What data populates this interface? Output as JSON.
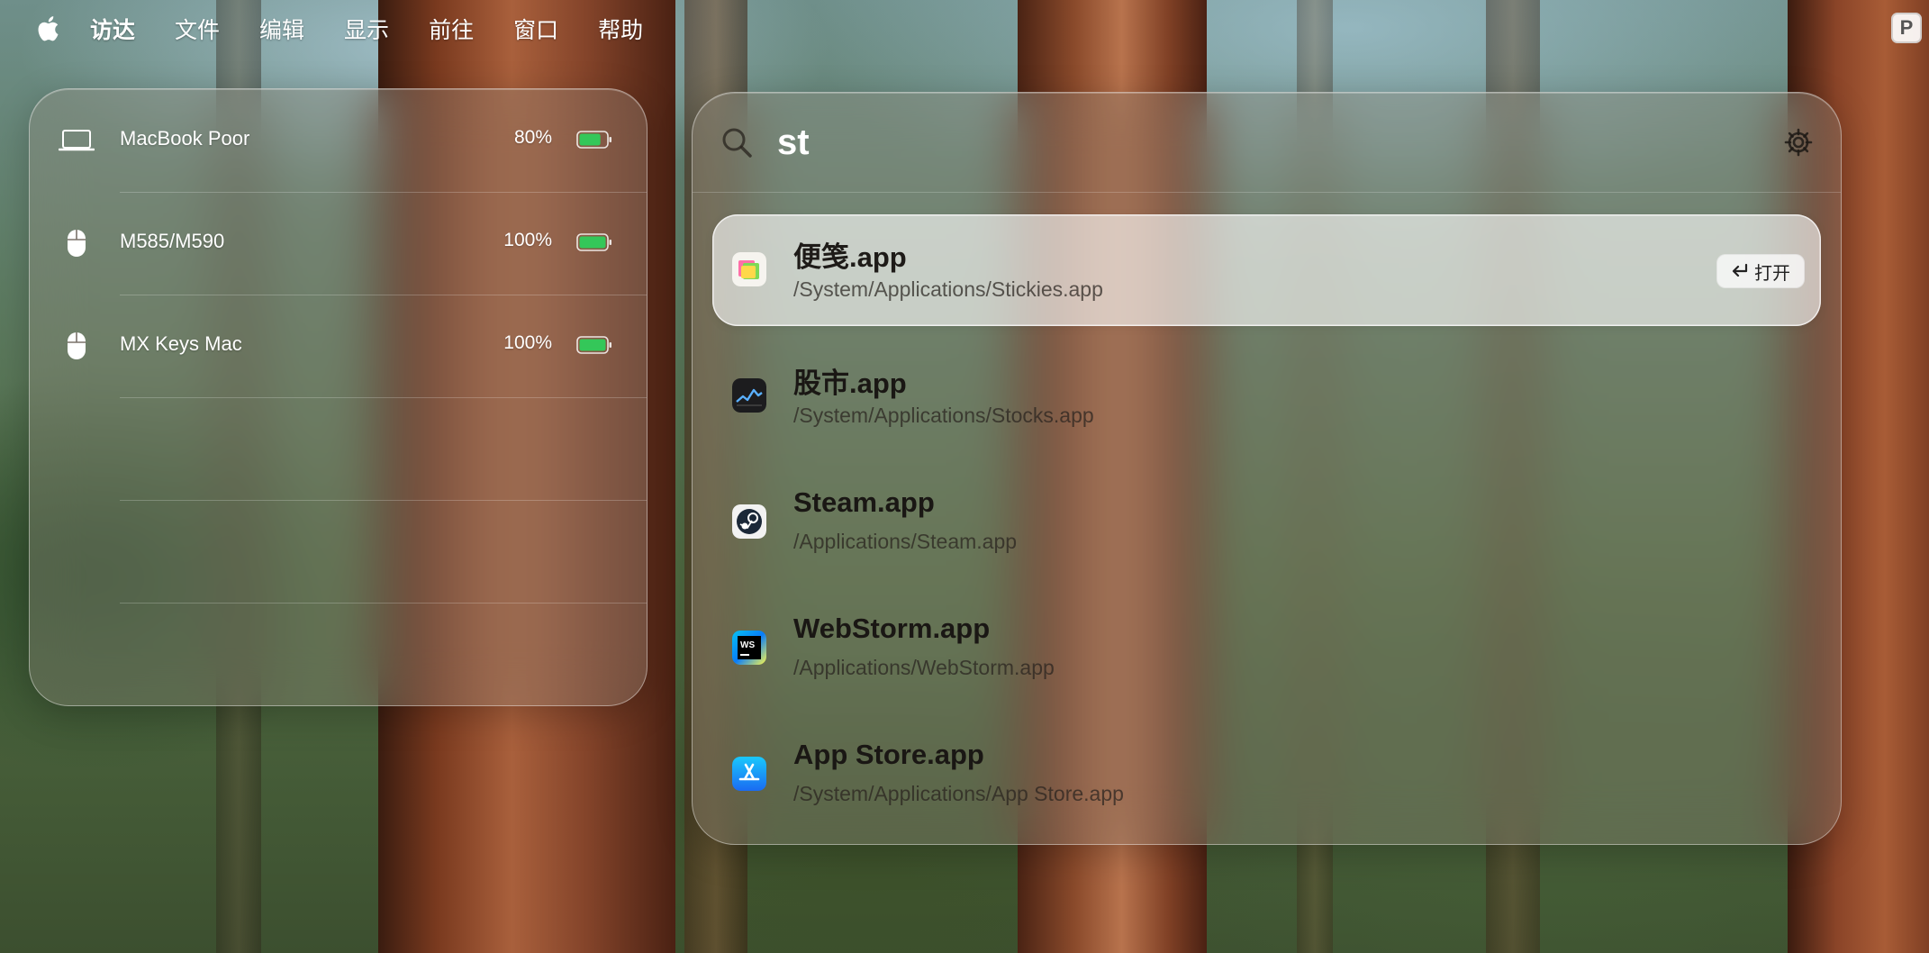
{
  "menubar": {
    "apple_icon": "apple-icon",
    "items": [
      "访达",
      "文件",
      "编辑",
      "显示",
      "前往",
      "窗口",
      "帮助"
    ],
    "status_icon_label": "P"
  },
  "devices": [
    {
      "name": "MacBook Poor",
      "icon": "laptop-icon",
      "battery": "80%",
      "level": 0.8
    },
    {
      "name": "M585/M590",
      "icon": "mouse-icon",
      "battery": "100%",
      "level": 1.0
    },
    {
      "name": "MX Keys Mac",
      "icon": "mouse-icon",
      "battery": "100%",
      "level": 1.0
    }
  ],
  "search": {
    "query": "st",
    "results": [
      {
        "name": "便笺.app",
        "path": "/System/Applications/Stickies.app",
        "icon": "stickies-icon",
        "selected": true,
        "action_label": "打开"
      },
      {
        "name": "股市.app",
        "path": "/System/Applications/Stocks.app",
        "icon": "stocks-icon"
      },
      {
        "name": "Steam.app",
        "path": "/Applications/Steam.app",
        "icon": "steam-icon"
      },
      {
        "name": "WebStorm.app",
        "path": "/Applications/WebStorm.app",
        "icon": "webstorm-icon",
        "icon_label": "WS"
      },
      {
        "name": "App Store.app",
        "path": "/System/Applications/App Store.app",
        "icon": "app-store-icon"
      }
    ]
  },
  "colors": {
    "battery_green": "#34c759",
    "panel_glass": "#968c82",
    "selected_row": "#ffffff"
  }
}
